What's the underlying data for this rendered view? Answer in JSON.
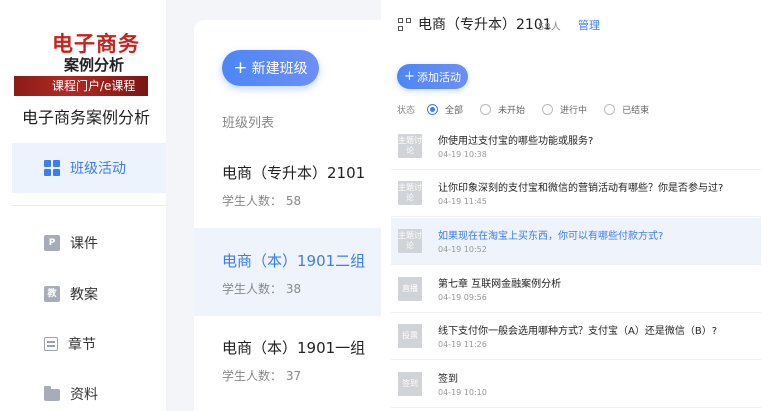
{
  "sidebar": {
    "cover": {
      "line1": "电子商务",
      "line2": "案例分析",
      "line3": "课程门户/e课程"
    },
    "course_title": "电子商务案例分析",
    "nav": [
      {
        "label": "班级活动",
        "icon": "grid-icon",
        "active": true
      },
      {
        "label": "课件",
        "icon": "courseware-icon",
        "badge": "P"
      },
      {
        "label": "教案",
        "icon": "lesson-plan-icon",
        "badge": "教"
      },
      {
        "label": "章节",
        "icon": "chapter-list-icon"
      },
      {
        "label": "资料",
        "icon": "folder-icon"
      }
    ]
  },
  "middle": {
    "new_class_label": "新建班级",
    "list_header": "班级列表",
    "classes": [
      {
        "name": "电商（专升本）2101",
        "students": "学生人数： 58"
      },
      {
        "name": "电商（本）1901二组",
        "students": "学生人数： 38",
        "selected": true
      },
      {
        "name": "电商（本）1901一组",
        "students": "学生人数： 37"
      }
    ]
  },
  "right": {
    "title": "电商（专升本）2101",
    "count": "58人",
    "manage": "管理",
    "add_activity": "添加活动",
    "filter": {
      "label": "状态",
      "options": [
        "全部",
        "未开始",
        "进行中",
        "已结束"
      ],
      "selected": "全部"
    },
    "activities": [
      {
        "tag": "主题讨论",
        "title": "你使用过支付宝的哪些功能或服务?",
        "time": "04-19 10:38"
      },
      {
        "tag": "主题讨论",
        "title": "让你印象深刻的支付宝和微信的营销活动有哪些？你是否参与过?",
        "time": "04-19 11:45"
      },
      {
        "tag": "主题讨论",
        "title": "如果现在在淘宝上买东西，你可以有哪些付款方式?",
        "time": "04-19 10:52",
        "highlight": true
      },
      {
        "tag": "直播",
        "title": "第七章 互联网金融案例分析",
        "time": "04-19 09:56"
      },
      {
        "tag": "投票",
        "title": "线下支付你一般会选用哪种方式？支付宝（A）还是微信（B）?",
        "time": "04-19 11:26"
      },
      {
        "tag": "签到",
        "title": "签到",
        "time": "04-19 10:10"
      }
    ]
  },
  "colors": {
    "accent": "#3b7df5",
    "selected_bg": "#eef3fc",
    "tag_gray": "#d0d3d8"
  }
}
